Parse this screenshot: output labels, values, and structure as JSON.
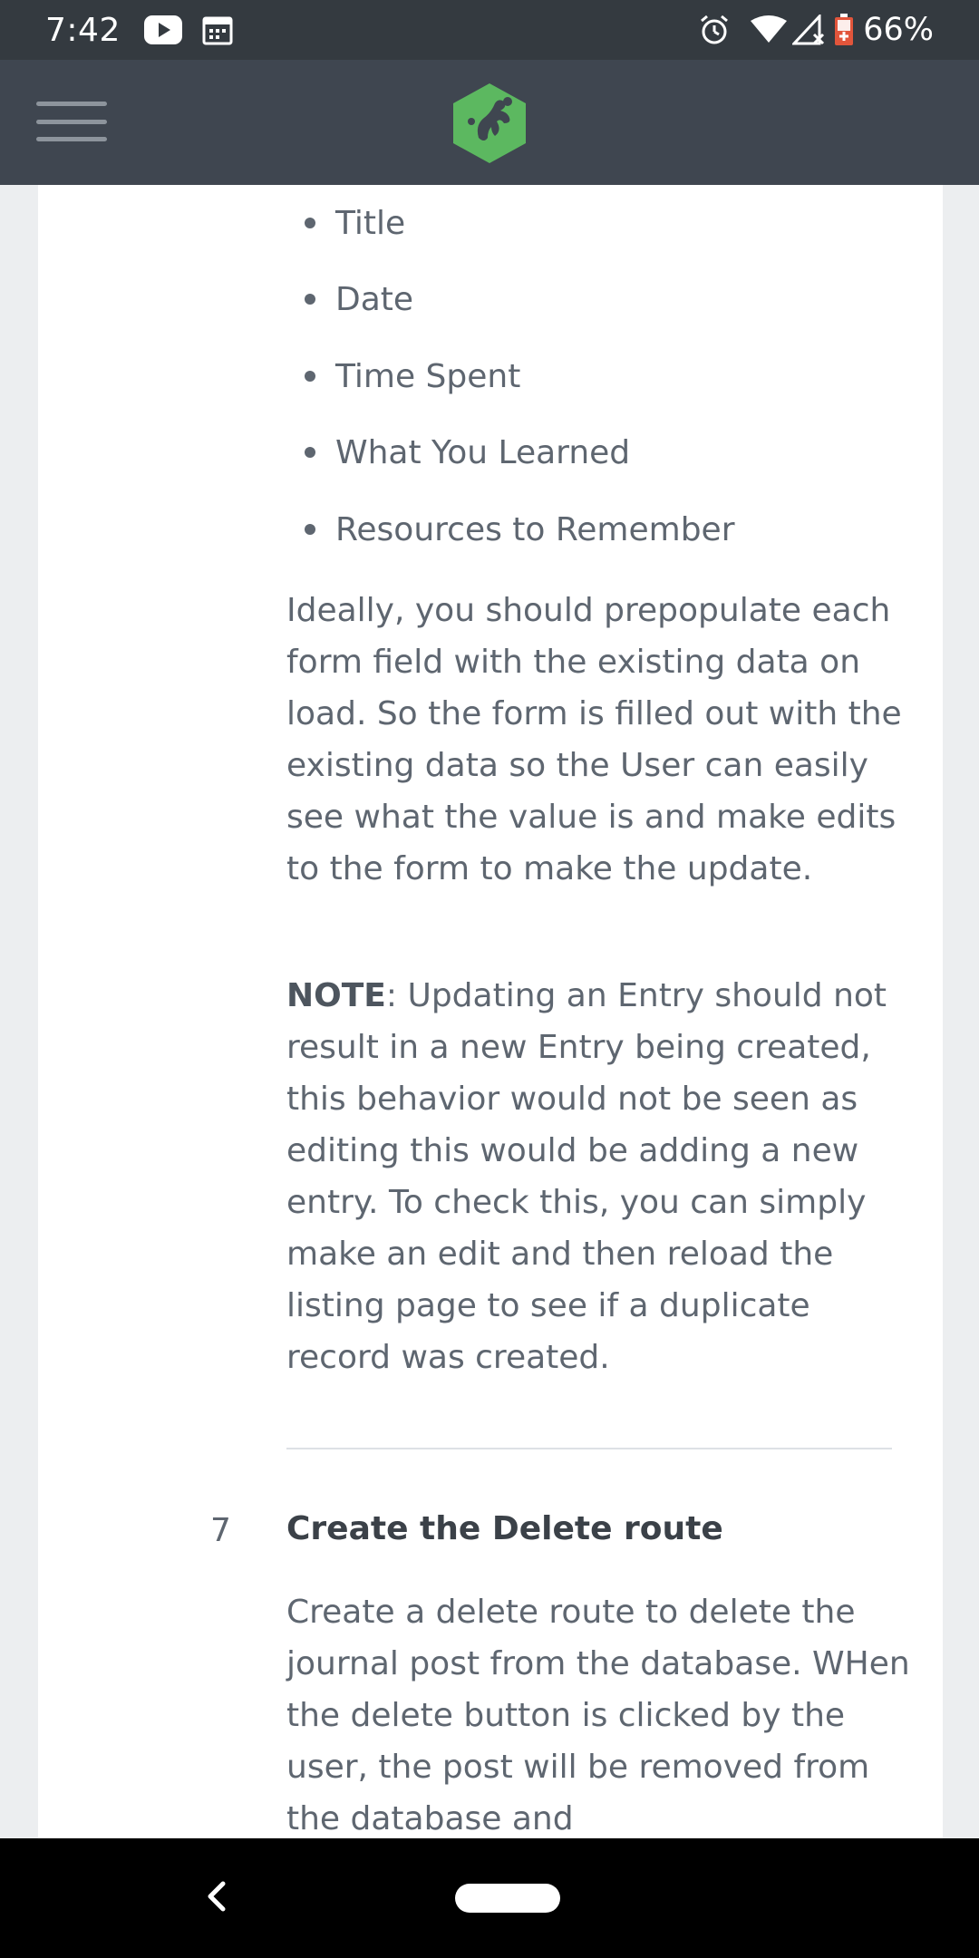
{
  "status_bar": {
    "time": "7:42",
    "battery": "66%",
    "icons": [
      "youtube-icon",
      "calendar-icon",
      "alarm-icon",
      "wifi-icon",
      "signal-icon",
      "battery-icon"
    ]
  },
  "header": {
    "menu_icon": "hamburger-menu-icon",
    "logo_icon": "treehouse-logo-icon",
    "brand_color": "#5cb860"
  },
  "content": {
    "bullets": [
      "Title",
      "Date",
      "Time Spent",
      "What You Learned",
      "Resources to Remember"
    ],
    "paragraph1": "Ideally, you should prepopulate each form field with the existing data on load. So the form is filled out with the existing data so the User can easily see what the value is and make edits to the form to make the update.",
    "note_label": "NOTE",
    "note_text": ": Updating an Entry should not result in a new Entry being created, this behavior would not be seen as editing this would be adding a new entry. To check this, you can simply make an edit and then reload the listing page to see if a duplicate record was created.",
    "step": {
      "number": "7",
      "title": "Create the Delete route",
      "text": "Create a delete route to delete the journal post from the database. WHen the delete button is clicked by the user, the post will be removed from the database and"
    }
  },
  "nav_bar": {
    "back_icon": "back-chevron-icon",
    "home_icon": "home-pill-icon"
  }
}
